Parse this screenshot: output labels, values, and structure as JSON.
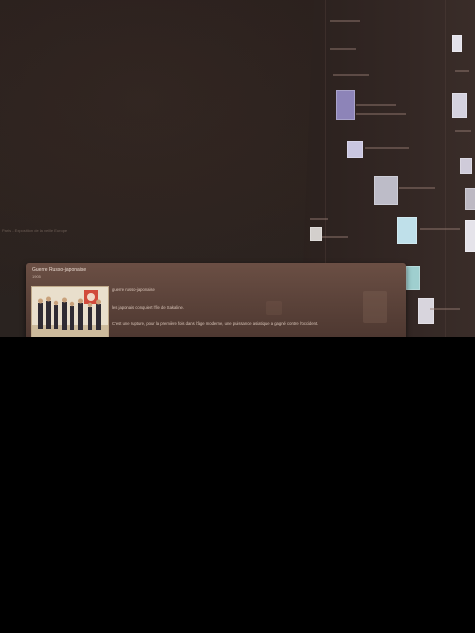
{
  "popup": {
    "title": "Guerre Russo-japonaise",
    "year": "1905",
    "lines": [
      "guerre russo-japonaise",
      "les japonais conquiert l'île de Sakaline.",
      "C'est une rupture, pour la première fois dans l'âge moderne, une puissance asiatique a gagné contre l'occident."
    ],
    "image_icon": "historical-illustration-soldiers"
  },
  "background": {
    "left_caption": "Paris - Exposition de la veille Europe",
    "colors": {
      "backdrop": "#2a201d",
      "card": "#5d443b",
      "bottom": "#000000"
    }
  }
}
